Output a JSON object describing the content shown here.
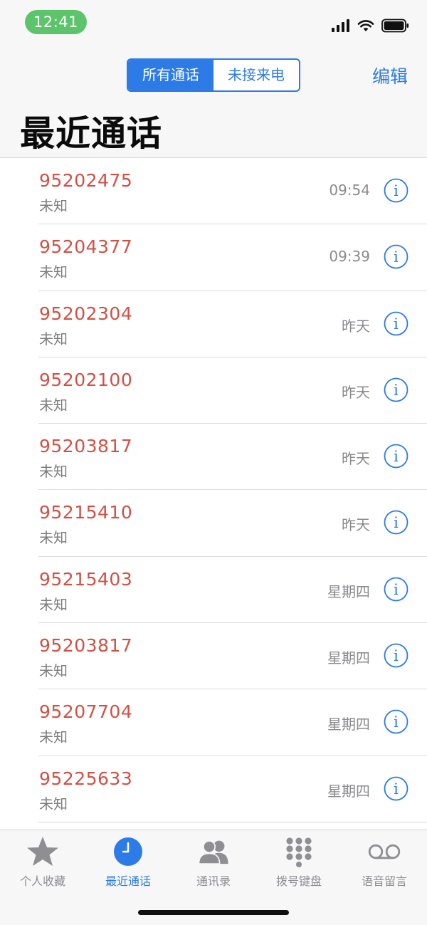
{
  "status_bar": {
    "time": "12:41"
  },
  "segmented": {
    "all_label": "所有通话",
    "missed_label": "未接来电"
  },
  "nav": {
    "edit_label": "编辑",
    "title": "最近通话"
  },
  "calls": [
    {
      "number": "95202475",
      "type": "未知",
      "time": "09:54"
    },
    {
      "number": "95204377",
      "type": "未知",
      "time": "09:39"
    },
    {
      "number": "95202304",
      "type": "未知",
      "time": "昨天"
    },
    {
      "number": "95202100",
      "type": "未知",
      "time": "昨天"
    },
    {
      "number": "95203817",
      "type": "未知",
      "time": "昨天"
    },
    {
      "number": "95215410",
      "type": "未知",
      "time": "昨天"
    },
    {
      "number": "95215403",
      "type": "未知",
      "time": "星期四"
    },
    {
      "number": "95203817",
      "type": "未知",
      "time": "星期四"
    },
    {
      "number": "95207704",
      "type": "未知",
      "time": "星期四"
    },
    {
      "number": "95225633",
      "type": "未知",
      "time": "星期四"
    }
  ],
  "tabbar": {
    "favorites_label": "个人收藏",
    "recents_label": "最近通话",
    "contacts_label": "通讯录",
    "keypad_label": "拨号键盘",
    "voicemail_label": "语音留言"
  },
  "colors": {
    "accent": "#2d7be6",
    "missed_number": "#d44f43",
    "status_time_pill": "#5cc46a"
  },
  "icons": {
    "favorites": "star-icon",
    "recents": "clock-icon",
    "contacts": "people-icon",
    "keypad": "keypad-icon",
    "voicemail": "voicemail-icon",
    "info": "info-icon"
  }
}
